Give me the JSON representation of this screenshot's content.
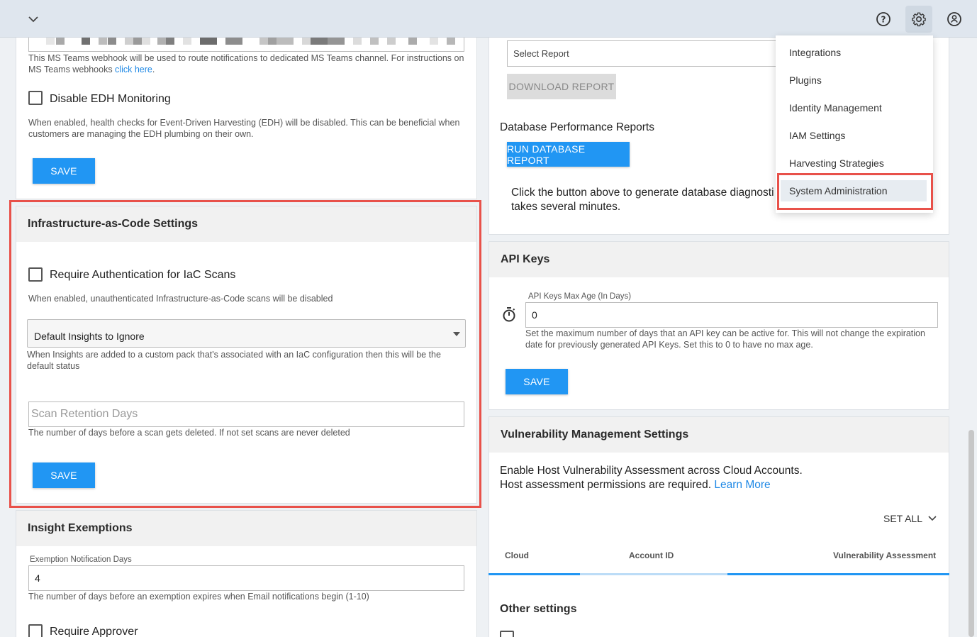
{
  "topbar": {
    "collapse_icon": "chevron-down-icon",
    "help_icon": "help-circle-icon",
    "settings_icon": "gear-icon",
    "account_icon": "account-circle-icon"
  },
  "settings_menu": {
    "items": [
      {
        "label": "Integrations"
      },
      {
        "label": "Plugins"
      },
      {
        "label": "Identity Management"
      },
      {
        "label": "IAM Settings"
      },
      {
        "label": "Harvesting Strategies"
      },
      {
        "label": "System Administration"
      }
    ],
    "selected": "System Administration"
  },
  "notifications": {
    "teams_help_prefix": "This MS Teams webhook will be used to route notifications to dedicated MS Teams channel. For instructions on MS Teams webhooks ",
    "teams_help_link": "click here",
    "teams_help_suffix": ".",
    "disable_edh_label": "Disable EDH Monitoring",
    "disable_edh_checked": false,
    "disable_edh_help": "When enabled, health checks for Event-Driven Harvesting (EDH) will be disabled. This can be beneficial when customers are managing the EDH plumbing on their own.",
    "save_label": "SAVE"
  },
  "iac": {
    "title": "Infrastructure-as-Code Settings",
    "require_auth_label": "Require Authentication for IaC Scans",
    "require_auth_checked": false,
    "require_auth_help": "When enabled, unauthenticated Infrastructure-as-Code scans will be disabled",
    "default_insights_value": "Default Insights to Ignore",
    "default_insights_help": "When Insights are added to a custom pack that's associated with an IaC configuration then this will be the default status",
    "retention_placeholder": "Scan Retention Days",
    "retention_help": "The number of days before a scan gets deleted. If not set scans are never deleted",
    "save_label": "SAVE"
  },
  "exemptions": {
    "title": "Insight Exemptions",
    "days_label": "Exemption Notification Days",
    "days_value": "4",
    "days_help": "The number of days before an exemption expires when Email notifications begin (1-10)",
    "require_approver_label": "Require Approver"
  },
  "reports": {
    "select_placeholder": "Select Report",
    "download_label": "DOWNLOAD REPORT",
    "db_title": "Database Performance Reports",
    "run_db_label": "RUN DATABASE REPORT",
    "db_help_line1": "Click the button above to generate database diagnosti",
    "db_help_line2": "takes several minutes."
  },
  "api_keys": {
    "title": "API Keys",
    "timer_icon": "timer-icon",
    "max_age_label": "API Keys Max Age (In Days)",
    "max_age_value": "0",
    "max_age_help": "Set the maximum number of days that an API key can be active for. This will not change the expiration date for previously generated API Keys. Set this to 0 to have no max age.",
    "save_label": "SAVE"
  },
  "vulnerability": {
    "title": "Vulnerability Management Settings",
    "desc_line1": "Enable Host Vulnerability Assessment across Cloud Accounts.",
    "desc_line2": "Host assessment permissions are required.",
    "learn_more": "Learn More",
    "set_all": "SET ALL",
    "columns": [
      "Cloud",
      "Account ID",
      "Vulnerability Assessment"
    ],
    "other_settings": "Other settings"
  },
  "colors": {
    "accent": "#2196f3",
    "highlight": "#e8514a",
    "topbar": "#dfe6ee"
  }
}
